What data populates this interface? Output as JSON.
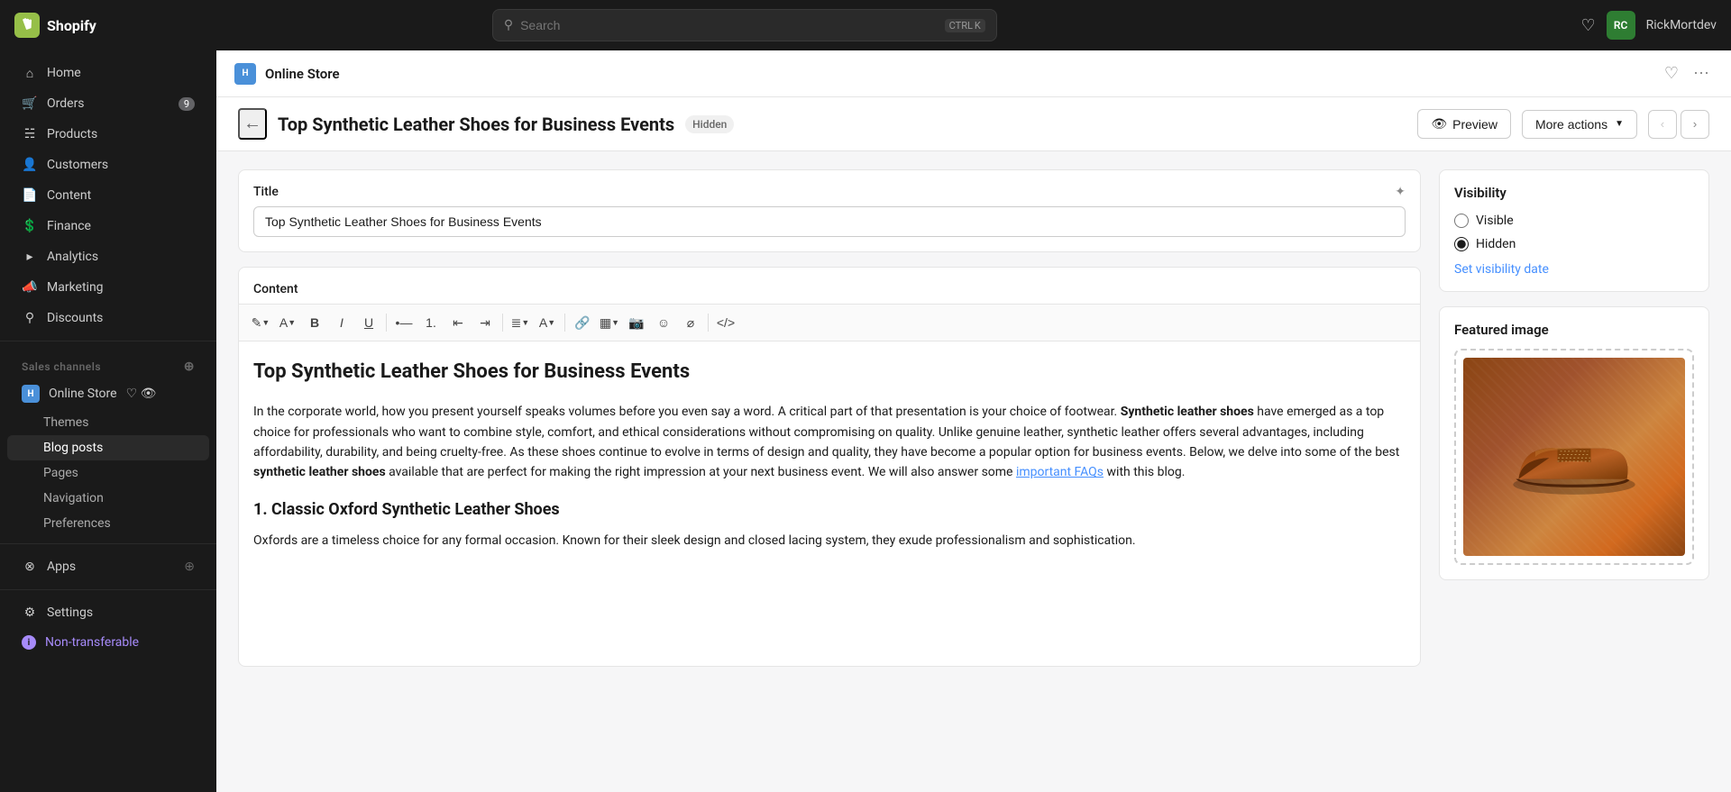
{
  "app": {
    "name": "Shopify",
    "logo_alt": "Shopify logo"
  },
  "topbar": {
    "search_placeholder": "Search",
    "search_shortcut_ctrl": "CTRL",
    "search_shortcut_key": "K",
    "username": "RickMortdev",
    "avatar_initials": "RC"
  },
  "sidebar": {
    "home_label": "Home",
    "orders_label": "Orders",
    "orders_badge": "9",
    "products_label": "Products",
    "customers_label": "Customers",
    "content_label": "Content",
    "finance_label": "Finance",
    "analytics_label": "Analytics",
    "marketing_label": "Marketing",
    "discounts_label": "Discounts",
    "sales_channels_label": "Sales channels",
    "online_store_label": "Online Store",
    "themes_label": "Themes",
    "blog_posts_label": "Blog posts",
    "pages_label": "Pages",
    "navigation_label": "Navigation",
    "preferences_label": "Preferences",
    "apps_label": "Apps",
    "settings_label": "Settings",
    "non_transferable_label": "Non-transferable"
  },
  "channel_bar": {
    "store_name": "Online Store",
    "store_badge": "H"
  },
  "page_header": {
    "title": "Top Synthetic Leather Shoes for Business Events",
    "status_badge": "Hidden",
    "preview_label": "Preview",
    "more_actions_label": "More actions"
  },
  "editor": {
    "title_label": "Title",
    "title_value": "Top Synthetic Leather Shoes for Business Events",
    "content_label": "Content",
    "article_heading": "Top Synthetic Leather Shoes for Business Events",
    "paragraph1": "In the corporate world, how you present yourself speaks volumes before you even say a word. A critical part of that presentation is your choice of footwear.",
    "bold_text1": "Synthetic leather shoes",
    "paragraph2_part1": " have emerged as a top choice for professionals who want to combine style, comfort, and ethical considerations without compromising on quality. Unlike genuine leather, synthetic leather offers several advantages, including affordability, durability, and being cruelty-free. As these shoes continue to evolve in terms of design and quality, they have become a popular option for business events. Below, we delve into some of the best ",
    "bold_text2": "synthetic leather shoes",
    "paragraph2_part2": " available that are perfect for making the right impression at your next business event. We will also answer some ",
    "link_text": "important FAQs",
    "paragraph2_end": " with this blog.",
    "section2_heading": "1. Classic Oxford Synthetic Leather Shoes",
    "paragraph3": "Oxfords are a timeless choice for any formal occasion. Known for their sleek design and closed lacing system, they exude professionalism and sophistication."
  },
  "visibility": {
    "title": "Visibility",
    "visible_label": "Visible",
    "hidden_label": "Hidden",
    "set_visibility_date_label": "Set visibility date",
    "current_value": "hidden"
  },
  "featured_image": {
    "title": "Featured image"
  }
}
